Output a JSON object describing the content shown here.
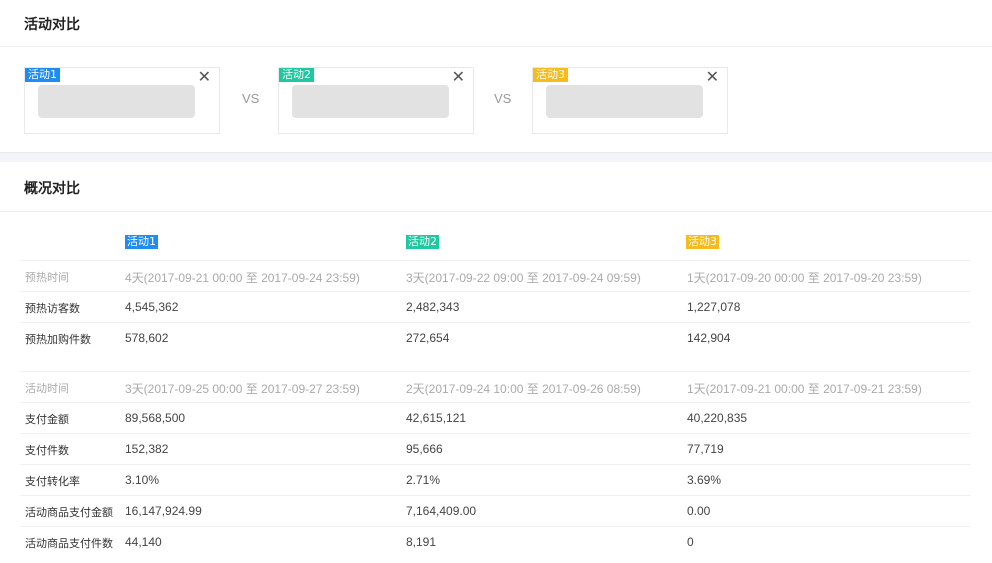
{
  "compare": {
    "title": "活动对比",
    "vs_label": "VS",
    "close_glyph": "✕",
    "activities": [
      {
        "tag": "活动1",
        "color": "#1e8cf0"
      },
      {
        "tag": "活动2",
        "color": "#1ec8a0"
      },
      {
        "tag": "活动3",
        "color": "#f7bb1c"
      }
    ]
  },
  "overview": {
    "title": "概况对比",
    "columns": [
      "活动1",
      "活动2",
      "活动3"
    ],
    "rows": [
      {
        "label": "预热时间",
        "values": [
          "4天(2017-09-21 00:00 至 2017-09-24 23:59)",
          "3天(2017-09-22 09:00 至 2017-09-24 09:59)",
          "1天(2017-09-20 00:00 至 2017-09-20 23:59)"
        ],
        "muted": true
      },
      {
        "label": "预热访客数",
        "values": [
          "4,545,362",
          "2,482,343",
          "1,227,078"
        ]
      },
      {
        "label": "预热加购件数",
        "values": [
          "578,602",
          "272,654",
          "142,904"
        ]
      },
      {
        "label": "活动时间",
        "values": [
          "3天(2017-09-25 00:00 至 2017-09-27 23:59)",
          "2天(2017-09-24 10:00 至 2017-09-26 08:59)",
          "1天(2017-09-21 00:00 至 2017-09-21 23:59)"
        ],
        "muted": true
      },
      {
        "label": "支付金额",
        "values": [
          "89,568,500",
          "42,615,121",
          "40,220,835"
        ]
      },
      {
        "label": "支付件数",
        "values": [
          "152,382",
          "95,666",
          "77,719"
        ]
      },
      {
        "label": "支付转化率",
        "values": [
          "3.10%",
          "2.71%",
          "3.69%"
        ]
      },
      {
        "label": "活动商品支付金额",
        "values": [
          "16,147,924.99",
          "7,164,409.00",
          "0.00"
        ]
      },
      {
        "label": "活动商品支付件数",
        "values": [
          "44,140",
          "8,191",
          "0"
        ]
      }
    ]
  }
}
